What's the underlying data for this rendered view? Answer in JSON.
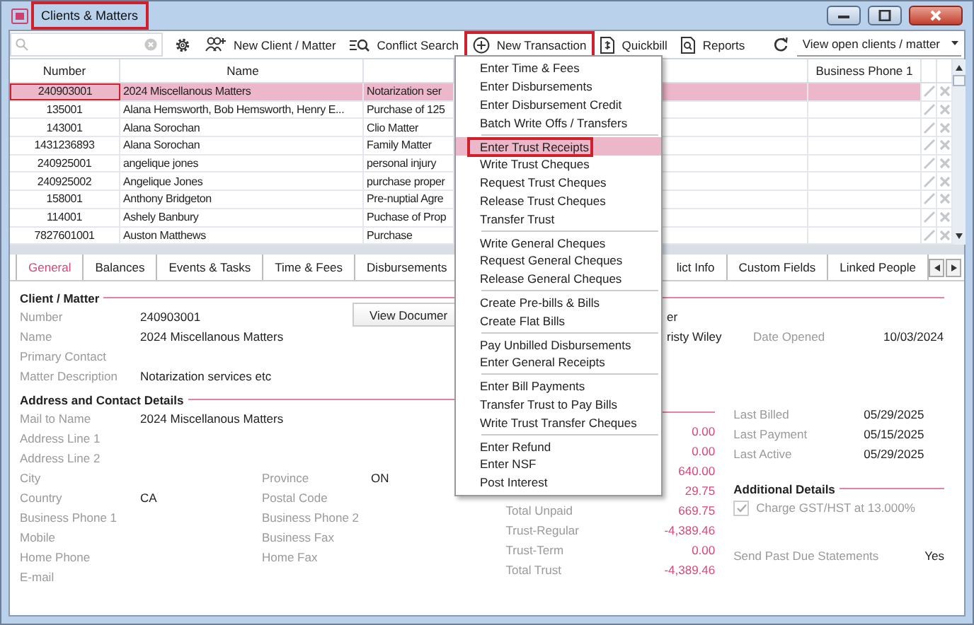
{
  "window": {
    "title": "Clients & Matters",
    "title_outlined": true
  },
  "toolbar": [
    {
      "kind": "settings"
    },
    {
      "kind": "new_client",
      "label": "New Client / Matter",
      "outlined": false
    },
    {
      "kind": "conflict",
      "label": "Conflict Search",
      "outlined": false
    },
    {
      "kind": "new_transaction",
      "label": "New Transaction",
      "outlined": true
    },
    {
      "kind": "quickbill",
      "label": "Quickbill",
      "outlined": false
    },
    {
      "kind": "reports",
      "label": "Reports",
      "outlined": false
    }
  ],
  "view_filter": "View open clients / matter",
  "table": {
    "columns": {
      "number": "Number",
      "name": "Name",
      "business_phone_1": "Business Phone 1"
    },
    "rows": [
      {
        "number": "240903001",
        "name": "2024 Miscellanous Matters",
        "column_3": "Notarization ser",
        "selected": true,
        "outlined": true
      },
      {
        "number": "135001",
        "name": "Alana Hemsworth, Bob Hemsworth, Henry E...",
        "column_3": "Purchase of 125",
        "selected": false,
        "outlined": false
      },
      {
        "number": "143001",
        "name": "Alana Sorochan",
        "column_3": "Clio Matter",
        "selected": false,
        "outlined": false
      },
      {
        "number": "1431236893",
        "name": "Alana Sorochan",
        "column_3": "Family Matter",
        "selected": false,
        "outlined": false
      },
      {
        "number": "240925001",
        "name": "angelique jones",
        "column_3": "personal injury",
        "selected": false,
        "outlined": false
      },
      {
        "number": "240925002",
        "name": "Angelique Jones",
        "column_3": "purchase proper",
        "selected": false,
        "outlined": false
      },
      {
        "number": "158001",
        "name": "Anthony Bridgeton",
        "column_3": "Pre-nuptial Agre",
        "selected": false,
        "outlined": false
      },
      {
        "number": "114001",
        "name": "Ashely Banbury",
        "column_3": "Puchase of Prop",
        "selected": false,
        "outlined": false
      },
      {
        "number": "7827601001",
        "name": "Auston Matthews",
        "column_3": "Purchase",
        "selected": false,
        "outlined": false
      }
    ]
  },
  "tabs_left": [
    {
      "label": "General",
      "selected": true
    },
    {
      "label": "Balances",
      "selected": false
    },
    {
      "label": "Events & Tasks",
      "selected": false
    },
    {
      "label": "Time & Fees",
      "selected": false
    },
    {
      "label": "Disbursements",
      "selected": false
    }
  ],
  "tabs_right": [
    {
      "label": "lict Info",
      "selected": false
    },
    {
      "label": "Custom Fields",
      "selected": false
    },
    {
      "label": "Linked People",
      "selected": false
    }
  ],
  "client_matter": {
    "title": "Client / Matter",
    "view_documents": "View Documer",
    "rows": [
      {
        "label": "Number",
        "value": "240903001",
        "column_3": "er"
      },
      {
        "label": "Name",
        "value": "2024 Miscellanous Matters",
        "column_3": "risty Wiley",
        "label_2": "Date Opened",
        "value_2": "10/03/2024"
      },
      {
        "label": "Primary Contact"
      },
      {
        "label": "Matter Description",
        "value": "Notarization services etc"
      }
    ]
  },
  "address": {
    "title": "Address and Contact Details",
    "rows": [
      {
        "label": "Mail to Name",
        "value": "2024 Miscellanous Matters"
      },
      {
        "label": "Address Line 1"
      },
      {
        "label": "Address Line 2"
      },
      {
        "label": "City",
        "label_2": "Province",
        "value_2": "ON"
      },
      {
        "label": "Country",
        "value": "CA",
        "label_2": "Postal Code"
      },
      {
        "label": "Business Phone 1",
        "label_2": "Business Phone 2"
      },
      {
        "label": "Mobile",
        "label_2": "Business Fax"
      },
      {
        "label": "Home Phone",
        "label_2": "Home Fax"
      },
      {
        "label": "E-mail"
      }
    ]
  },
  "balances": [
    {
      "amount": "0.00"
    },
    {
      "amount": "0.00"
    },
    {
      "amount": "640.00"
    },
    {
      "amount": "29.75"
    },
    {
      "label": "Total Unpaid",
      "amount": "669.75"
    },
    {
      "label": "Trust-Regular",
      "amount": "-4,389.46"
    },
    {
      "label": "Trust-Term",
      "amount": "0.00"
    },
    {
      "label": "Total Trust",
      "amount": "-4,389.46"
    }
  ],
  "dates": [
    {
      "label": "Last Billed",
      "value": "05/29/2025"
    },
    {
      "label": "Last Payment",
      "value": "05/15/2025"
    },
    {
      "label": "Last Active",
      "value": "05/29/2025"
    }
  ],
  "additional_details": {
    "title": "Additional Details",
    "gst": {
      "label": "Charge GST/HST at 13.000%",
      "checked": true,
      "disabled": true
    },
    "past_due": {
      "label": "Send Past Due Statements",
      "value": "Yes"
    }
  },
  "menu": [
    {
      "items": [
        {
          "label": "Enter Time & Fees",
          "selected": false,
          "outlined": false
        },
        {
          "label": "Enter Disbursements",
          "selected": false,
          "outlined": false
        },
        {
          "label": "Enter Disbursement Credit",
          "selected": false,
          "outlined": false
        },
        {
          "label": "Batch Write Offs / Transfers",
          "selected": false,
          "outlined": false
        }
      ]
    },
    {
      "items": [
        {
          "label": "Enter Trust Receipts",
          "selected": true,
          "outlined": true
        },
        {
          "label": "Write Trust Cheques",
          "selected": false,
          "outlined": false
        },
        {
          "label": "Request Trust Cheques",
          "selected": false,
          "outlined": false
        },
        {
          "label": "Release Trust Cheques",
          "selected": false,
          "outlined": false
        },
        {
          "label": "Transfer Trust",
          "selected": false,
          "outlined": false
        }
      ]
    },
    {
      "items": [
        {
          "label": "Write General Cheques",
          "selected": false,
          "outlined": false
        },
        {
          "label": "Request General Cheques",
          "selected": false,
          "outlined": false
        },
        {
          "label": "Release General Cheques",
          "selected": false,
          "outlined": false
        }
      ]
    },
    {
      "items": [
        {
          "label": "Create Pre-bills & Bills",
          "selected": false,
          "outlined": false
        },
        {
          "label": "Create Flat Bills",
          "selected": false,
          "outlined": false
        }
      ]
    },
    {
      "items": [
        {
          "label": "Pay Unbilled Disbursements",
          "selected": false,
          "outlined": false
        },
        {
          "label": "Enter General Receipts",
          "selected": false,
          "outlined": false
        }
      ]
    },
    {
      "items": [
        {
          "label": "Enter Bill Payments",
          "selected": false,
          "outlined": false
        },
        {
          "label": "Transfer Trust to Pay Bills",
          "selected": false,
          "outlined": false
        },
        {
          "label": "Write Trust Transfer Cheques",
          "selected": false,
          "outlined": false
        }
      ]
    },
    {
      "items": [
        {
          "label": "Enter Refund",
          "selected": false,
          "outlined": false
        },
        {
          "label": "Enter NSF",
          "selected": false,
          "outlined": false
        },
        {
          "label": "Post Interest",
          "selected": false,
          "outlined": false
        }
      ]
    }
  ]
}
